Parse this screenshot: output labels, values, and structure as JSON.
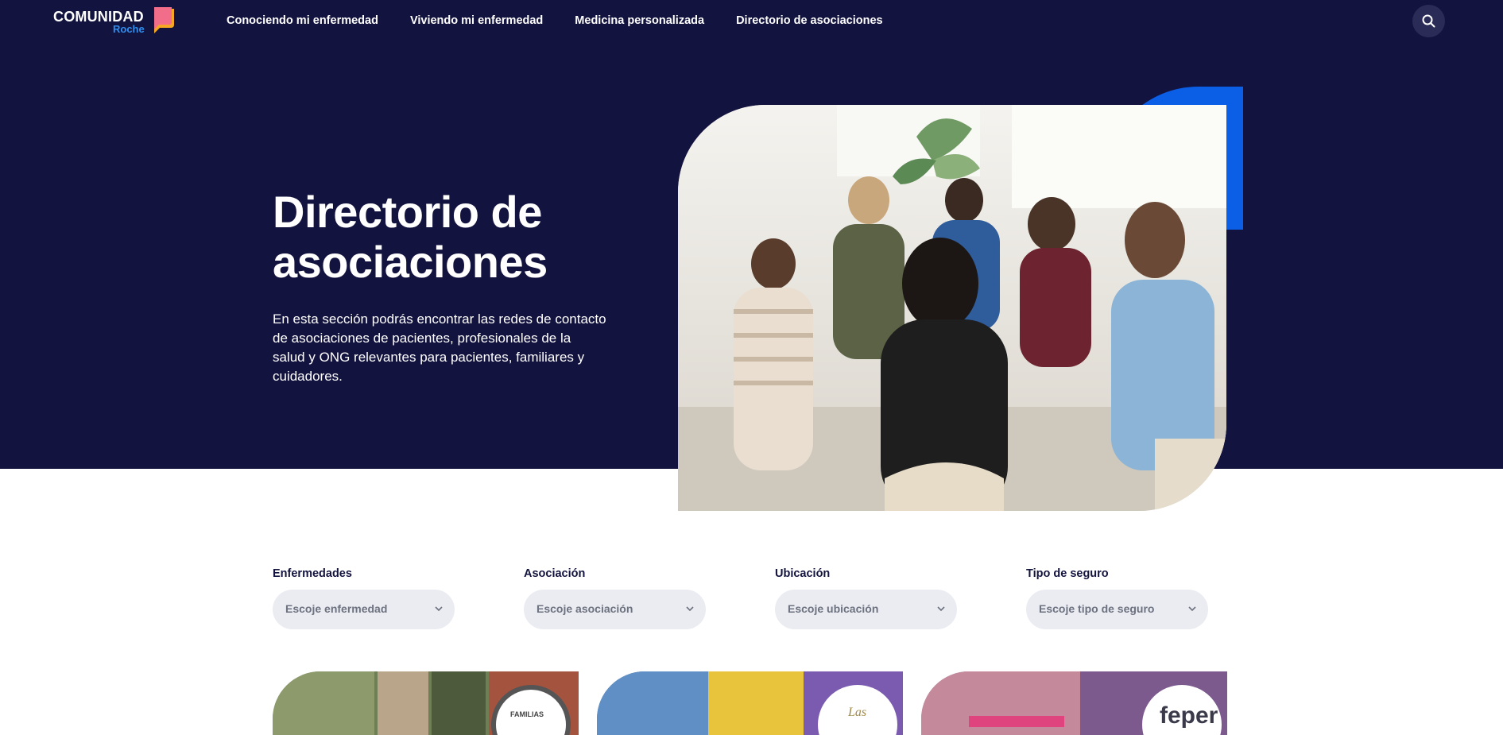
{
  "header": {
    "logo_text": "COMUNIDAD",
    "logo_sub": "Roche",
    "nav": [
      {
        "label": "Conociendo mi enfermedad"
      },
      {
        "label": "Viviendo mi enfermedad"
      },
      {
        "label": "Medicina personalizada"
      },
      {
        "label": "Directorio de asociaciones"
      }
    ],
    "search_icon": "search-icon"
  },
  "hero": {
    "title": "Directorio de asociaciones",
    "description": "En esta sección podrás encontrar las redes de contacto de asociaciones de pacientes, profesionales de la salud y ONG relevantes para pacientes, familiares y cuidadores."
  },
  "filters": [
    {
      "label": "Enfermedades",
      "placeholder": "Escoje enfermedad"
    },
    {
      "label": "Asociación",
      "placeholder": "Escoje asociación"
    },
    {
      "label": "Ubicación",
      "placeholder": "Escoje ubicación"
    },
    {
      "label": "Tipo de seguro",
      "placeholder": "Escoje tipo de seguro"
    }
  ],
  "cards": [
    {
      "logo_text": "FAMILIAS"
    },
    {
      "logo_text": "Las"
    },
    {
      "logo_text": "feper"
    }
  ],
  "colors": {
    "navy": "#13133f",
    "accent_blue": "#0b5ee6",
    "logo_sub_blue": "#2f8ff0",
    "logo_icon": "#f36b6b"
  }
}
